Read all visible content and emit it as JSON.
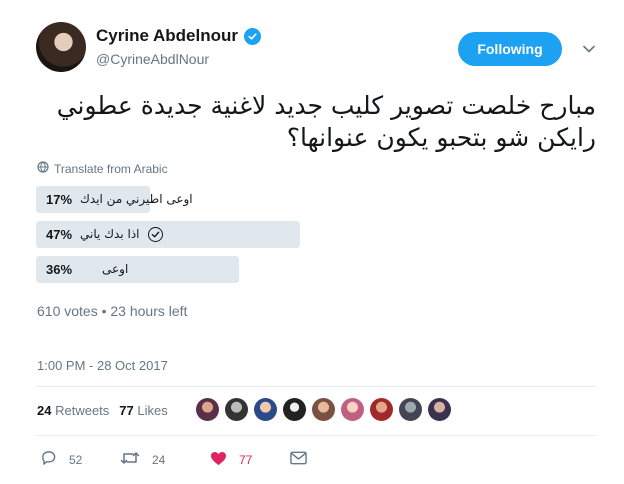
{
  "user": {
    "display_name": "Cyrine Abdelnour",
    "handle": "@CyrineAbdlNour",
    "verified_icon": "verified-badge-icon"
  },
  "follow_button": {
    "label": "Following",
    "color": "#1da1f2"
  },
  "tweet": {
    "text": "مبارح خلصت تصوير كليب جديد لاغنية جديدة عطوني رايكن شو بتحبو يكون عنوانها؟",
    "translate_label": "Translate from Arabic"
  },
  "poll": {
    "options": [
      {
        "percent": "17%",
        "value": 17,
        "label": "اوعى اطيرني من ايدك",
        "selected": false
      },
      {
        "percent": "47%",
        "value": 47,
        "label": "اذا بدك ياني",
        "selected": true
      },
      {
        "percent": "36%",
        "value": 36,
        "label": "اوعى",
        "selected": false
      }
    ],
    "meta": "610 votes • 23 hours left"
  },
  "timestamp": "1:00 PM - 28 Oct 2017",
  "stats": {
    "retweets_count": "24",
    "retweets_label": "Retweets",
    "likes_count": "77",
    "likes_label": "Likes"
  },
  "actions": {
    "reply_count": "52",
    "retweet_count": "24",
    "like_count": "77"
  },
  "colors": {
    "accent": "#1da1f2",
    "like": "#e0245e",
    "muted": "#657786",
    "poll_bar": "#e1e8ed"
  }
}
